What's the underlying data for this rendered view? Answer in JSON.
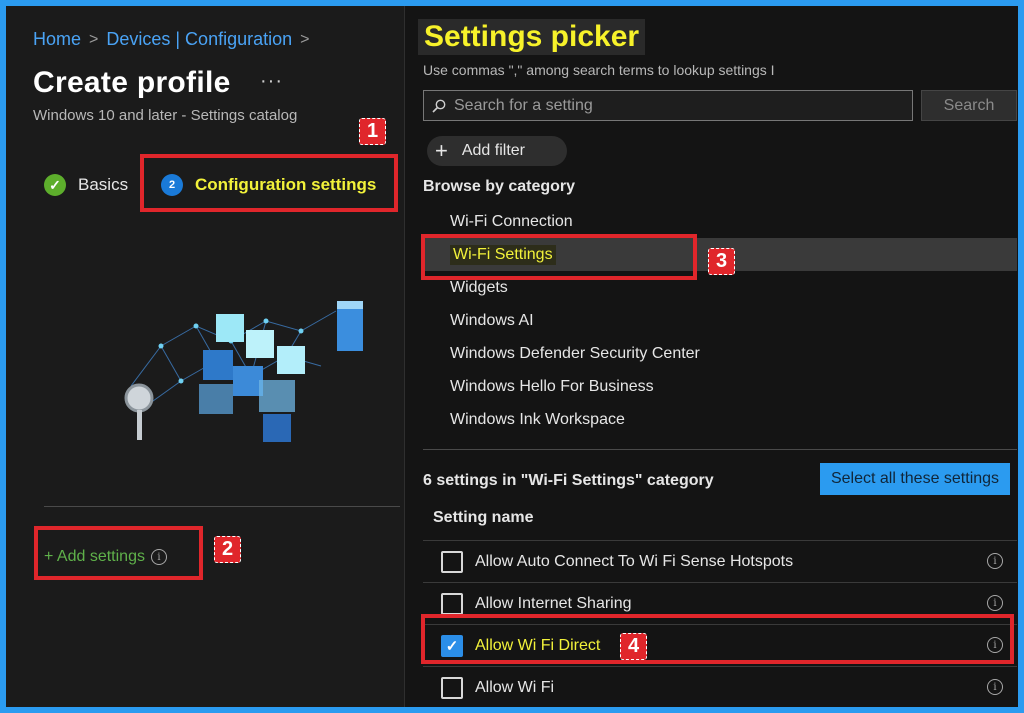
{
  "breadcrumb": {
    "home": "Home",
    "devices": "Devices | Configuration"
  },
  "left": {
    "title": "Create profile",
    "more": "···",
    "subtitle": "Windows 10 and later - Settings catalog",
    "tabs": [
      {
        "label": "Basics",
        "status": "complete"
      },
      {
        "label": "Configuration settings",
        "step": "2",
        "status": "current"
      }
    ],
    "add_settings_label": "+ Add settings"
  },
  "picker": {
    "title": "Settings picker",
    "hint": "Use commas \",\" among search terms to lookup settings I",
    "search_placeholder": "Search for a setting",
    "search_button": "Search",
    "add_filter": "Add filter",
    "browse_heading": "Browse by category",
    "categories": [
      "Wi-Fi Connection",
      "Wi-Fi Settings",
      "Widgets",
      "Windows AI",
      "Windows Defender Security Center",
      "Windows Hello For Business",
      "Windows Ink Workspace"
    ],
    "selected_category": "Wi-Fi Settings",
    "count_label": "6 settings in \"Wi-Fi Settings\" category",
    "select_all": "Select all these settings",
    "column_header": "Setting name",
    "settings": [
      {
        "label": "Allow Auto Connect To Wi Fi Sense Hotspots",
        "checked": false
      },
      {
        "label": "Allow Internet Sharing",
        "checked": false
      },
      {
        "label": "Allow Wi Fi Direct",
        "checked": true
      },
      {
        "label": "Allow Wi Fi",
        "checked": false
      }
    ]
  },
  "annotations": [
    "1",
    "2",
    "3",
    "4"
  ],
  "colors": {
    "accent": "#2b9bf0",
    "highlight": "#f2f23a",
    "callout": "#e0262b",
    "success": "#5dae2c"
  },
  "icons": [
    "chevron-right-icon",
    "more-icon",
    "check-icon",
    "search-icon",
    "plus-icon",
    "info-icon",
    "checkbox-icon"
  ]
}
